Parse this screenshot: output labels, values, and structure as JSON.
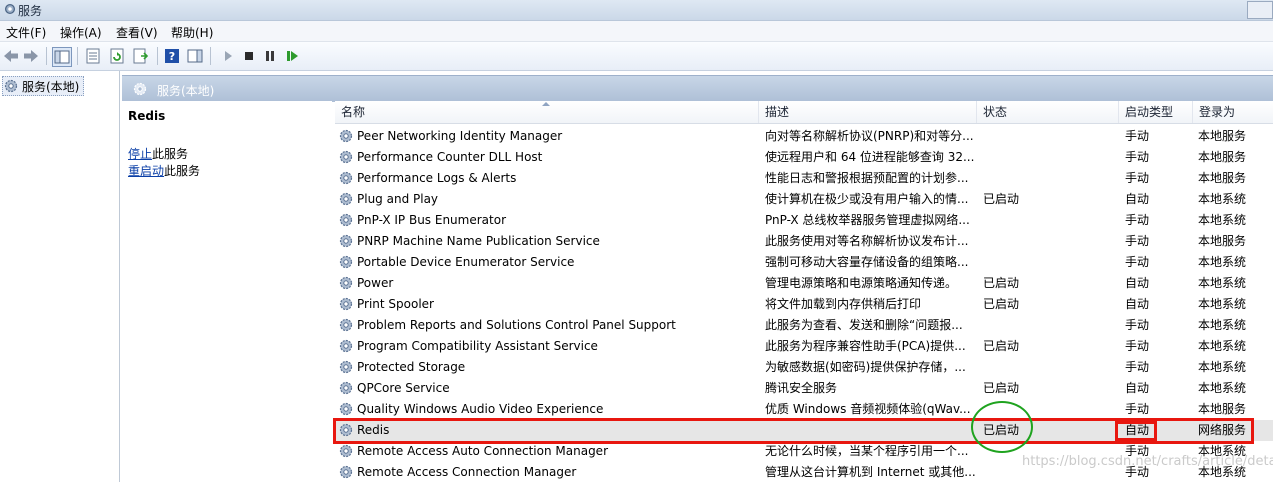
{
  "window": {
    "title": "服务"
  },
  "menu": [
    "文件(F)",
    "操作(A)",
    "查看(V)",
    "帮助(H)"
  ],
  "toolbar": {
    "icons": [
      "back-icon",
      "forward-icon",
      "show-hide-console-tree-icon",
      "properties-icon",
      "refresh-icon",
      "export-list-icon",
      "help-icon",
      "show-hide-action-pane-icon",
      "start-service-icon",
      "stop-service-icon",
      "pause-service-icon",
      "restart-service-icon"
    ]
  },
  "tree": {
    "root_label": "服务(本地)"
  },
  "pane": {
    "title": "服务(本地)"
  },
  "details": {
    "service_name": "Redis",
    "stop_link": "停止",
    "stop_suffix": "此服务",
    "restart_link": "重启动",
    "restart_suffix": "此服务"
  },
  "columns": {
    "name": "名称",
    "description": "描述",
    "status": "状态",
    "startup_type": "启动类型",
    "logon_as": "登录为"
  },
  "rows": [
    {
      "name": "Peer Networking Identity Manager",
      "desc": "向对等名称解析协议(PNRP)和对等分...",
      "status": "",
      "type": "手动",
      "logon": "本地服务"
    },
    {
      "name": "Performance Counter DLL Host",
      "desc": "使远程用户和 64 位进程能够查询 32...",
      "status": "",
      "type": "手动",
      "logon": "本地服务"
    },
    {
      "name": "Performance Logs & Alerts",
      "desc": "性能日志和警报根据预配置的计划参...",
      "status": "",
      "type": "手动",
      "logon": "本地服务"
    },
    {
      "name": "Plug and Play",
      "desc": "使计算机在极少或没有用户输入的情...",
      "status": "已启动",
      "type": "自动",
      "logon": "本地系统"
    },
    {
      "name": "PnP-X IP Bus Enumerator",
      "desc": "PnP-X 总线枚举器服务管理虚拟网络...",
      "status": "",
      "type": "手动",
      "logon": "本地系统"
    },
    {
      "name": "PNRP Machine Name Publication Service",
      "desc": "此服务使用对等名称解析协议发布计...",
      "status": "",
      "type": "手动",
      "logon": "本地服务"
    },
    {
      "name": "Portable Device Enumerator Service",
      "desc": "强制可移动大容量存储设备的组策略...",
      "status": "",
      "type": "手动",
      "logon": "本地系统"
    },
    {
      "name": "Power",
      "desc": "管理电源策略和电源策略通知传递。",
      "status": "已启动",
      "type": "自动",
      "logon": "本地系统"
    },
    {
      "name": "Print Spooler",
      "desc": "将文件加载到内存供稍后打印",
      "status": "已启动",
      "type": "自动",
      "logon": "本地系统"
    },
    {
      "name": "Problem Reports and Solutions Control Panel Support",
      "desc": "此服务为查看、发送和删除“问题报...",
      "status": "",
      "type": "手动",
      "logon": "本地系统"
    },
    {
      "name": "Program Compatibility Assistant Service",
      "desc": "此服务为程序兼容性助手(PCA)提供...",
      "status": "已启动",
      "type": "手动",
      "logon": "本地系统"
    },
    {
      "name": "Protected Storage",
      "desc": "为敏感数据(如密码)提供保护存储，...",
      "status": "",
      "type": "手动",
      "logon": "本地系统"
    },
    {
      "name": "QPCore Service",
      "desc": "腾讯安全服务",
      "status": "已启动",
      "type": "自动",
      "logon": "本地系统"
    },
    {
      "name": "Quality Windows Audio Video Experience",
      "desc": "优质 Windows 音频视频体验(qWav...",
      "status": "",
      "type": "手动",
      "logon": "本地服务"
    },
    {
      "name": "Redis",
      "desc": "",
      "status": "已启动",
      "type": "自动",
      "logon": "网络服务"
    },
    {
      "name": "Remote Access Auto Connection Manager",
      "desc": "无论什么时候，当某个程序引用一个...",
      "status": "",
      "type": "手动",
      "logon": "本地系统"
    },
    {
      "name": "Remote Access Connection Manager",
      "desc": "管理从这台计算机到 Internet 或其他...",
      "status": "",
      "type": "手动",
      "logon": "本地系统"
    }
  ],
  "watermark": "https://blog.csdn.net/crafts/article/details/8920"
}
